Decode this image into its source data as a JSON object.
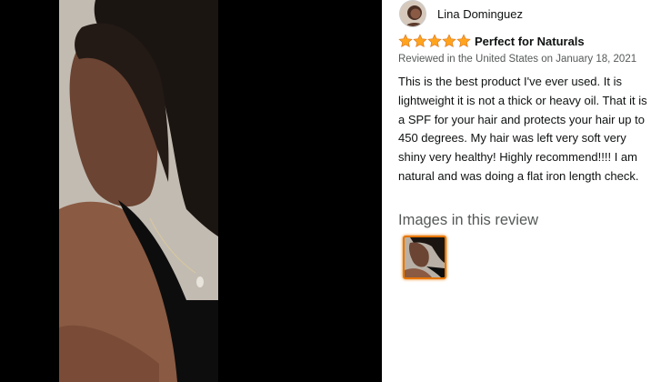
{
  "reviewer": {
    "name": "Lina Dominguez",
    "avatar_icon": "profile-avatar"
  },
  "review": {
    "rating": 5,
    "rating_max": 5,
    "star_color": "#ffa41c",
    "title": "Perfect for Naturals",
    "date": "Reviewed in the United States on January 18, 2021",
    "body": "This is the best product I've ever used. It is lightweight it is not a thick or heavy oil. That it is a SPF for your hair and protects your hair up to 450 degrees. My hair was left very soft very shiny very healthy! Highly recommend!!!! I am natural and was doing a flat iron length check."
  },
  "images_section": {
    "heading": "Images in this review",
    "thumbnail_count": 1,
    "selected_border_color": "#e77600"
  }
}
